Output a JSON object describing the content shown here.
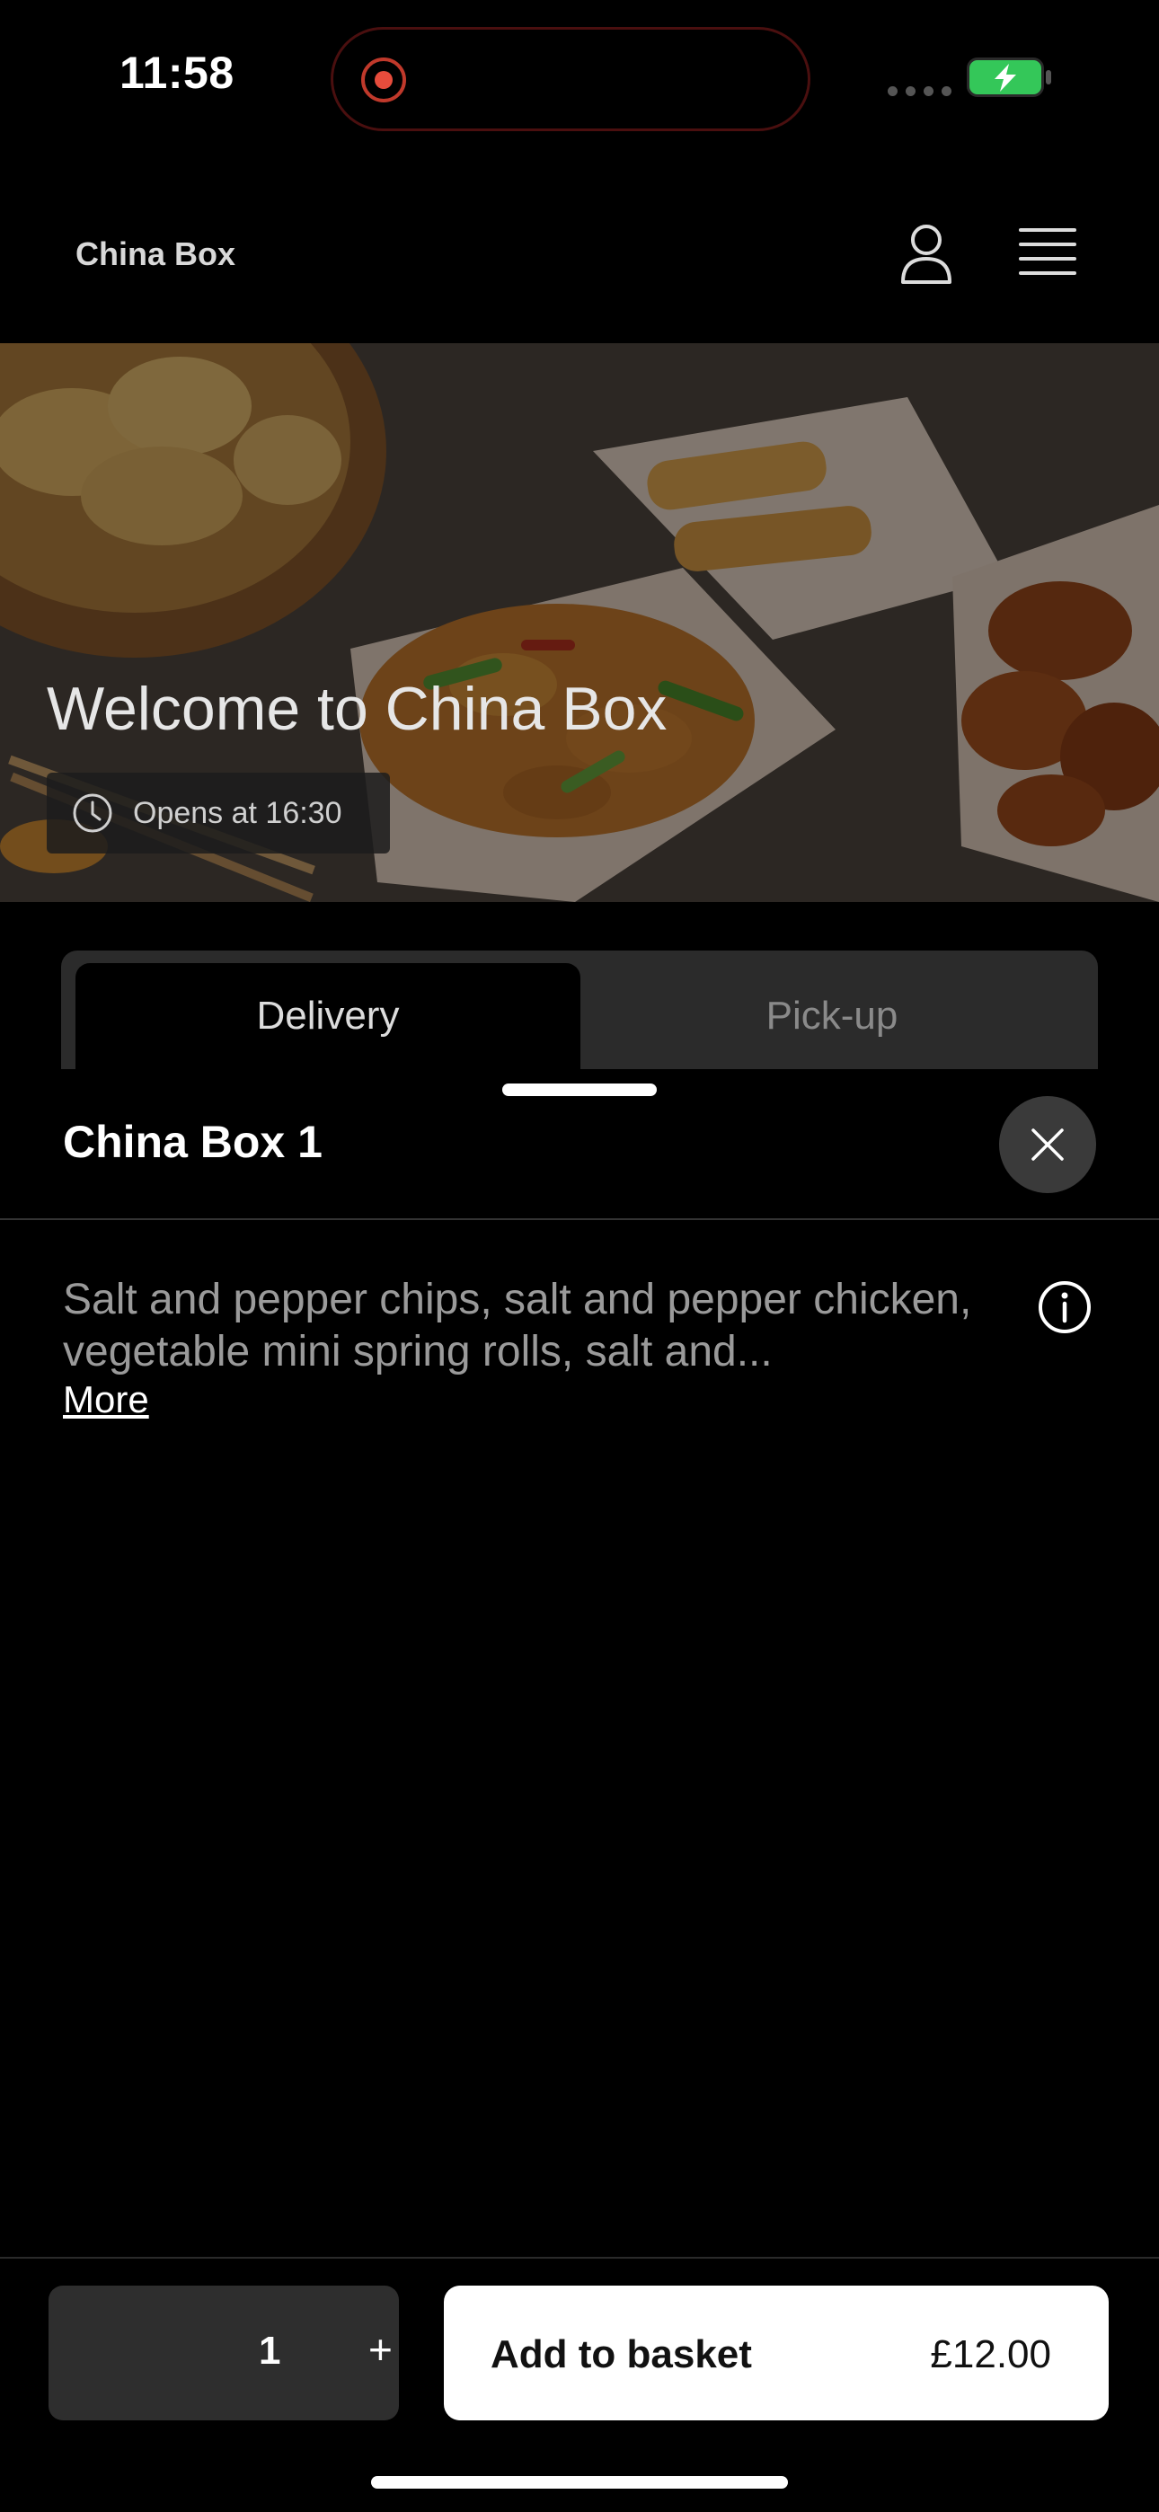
{
  "status_bar": {
    "time": "11:58",
    "recording": true,
    "battery_charging": true,
    "battery_color": "#34c759"
  },
  "header": {
    "brand": "China Box",
    "icons": [
      "user-icon",
      "menu-icon"
    ]
  },
  "hero": {
    "title": "Welcome to China Box",
    "hours_icon": "clock-icon",
    "hours_text": "Opens at 16:30"
  },
  "tabs": [
    {
      "label": "Delivery",
      "active": true
    },
    {
      "label": "Pick-up",
      "active": false
    }
  ],
  "item_sheet": {
    "title": "China Box 1",
    "description": "Salt and pepper chips, salt and pepper chicken, vegetable mini spring rolls, salt and...",
    "more_label": "More",
    "info_icon": "info-icon",
    "close_icon": "close-icon"
  },
  "footer": {
    "quantity": "1",
    "increment_label": "+",
    "add_label": "Add to basket",
    "price": "£12.00"
  }
}
